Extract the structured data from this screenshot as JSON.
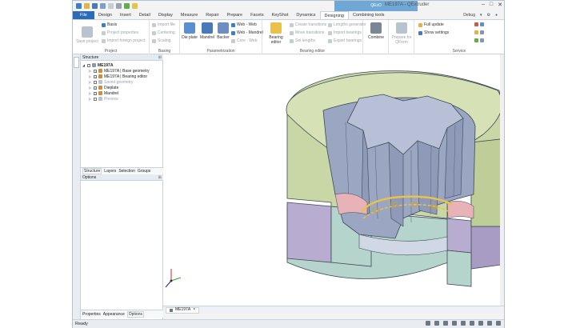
{
  "app": {
    "title": "ME197A - QExtruder",
    "active_context_tab": "QExO"
  },
  "menu": {
    "tabs": [
      "File",
      "Design",
      "Insert",
      "Detail",
      "Display",
      "Measure",
      "Repair",
      "Prepare",
      "Facets",
      "KeyShot",
      "Dynamics",
      "Designing",
      "Combining tools"
    ],
    "active": "Designing",
    "right": {
      "debug": "Debug"
    }
  },
  "ribbon": {
    "project": {
      "name": "Project",
      "save": "Save project",
      "basis": "Basis",
      "project_properties": "Project properties",
      "import_foreign": "Import foreign project"
    },
    "basing": {
      "name": "Basing",
      "import_file": "Import file",
      "centering": "Centering",
      "scaling": "Scaling"
    },
    "parametrization": {
      "name": "Parametrization",
      "die_plate": "Die plate",
      "mandrel": "Mandrel",
      "backer": "Backer",
      "web_web": "Web - Web",
      "web_mandrel": "Web - Mandrel",
      "core_web": "Core - Web"
    },
    "bearing_editor": {
      "name": "Bearing editor",
      "bearing_editor_btn": "Bearing editor",
      "create_transitions": "Create transitions",
      "move_transitions": "Move transitions",
      "set_lengths": "Set lengths",
      "lengths_generator": "Lengths generator",
      "import_bearings": "Import bearings",
      "export_bearings": "Export bearings"
    },
    "combine": {
      "combine": "Combine"
    },
    "qform": {
      "prepare": "Prepare for QForm"
    },
    "service": {
      "name": "Service",
      "full_update": "Full update",
      "show_settings": "Show settings"
    }
  },
  "structure": {
    "header": "Structure",
    "root": "ME197A",
    "items": [
      {
        "label": "ME197A | Base geometry",
        "checked": true,
        "disabled": false
      },
      {
        "label": "ME197A | Bearing editor",
        "checked": true,
        "disabled": false
      },
      {
        "label": "Saved geometry",
        "checked": false,
        "disabled": true
      },
      {
        "label": "Dieplate",
        "checked": true,
        "disabled": false
      },
      {
        "label": "Mandrel",
        "checked": true,
        "disabled": false
      },
      {
        "label": "Preview",
        "checked": false,
        "disabled": true
      }
    ],
    "tabs": [
      "Structure",
      "Layers",
      "Selection",
      "Groups"
    ],
    "active_tab": "Structure"
  },
  "options": {
    "header": "Options",
    "tabs": [
      "Properties",
      "Appearance",
      "Options"
    ],
    "active_tab": "Options"
  },
  "document": {
    "tab": "ME197A"
  },
  "status": {
    "text": "Ready"
  },
  "colors": {
    "accent": "#2b6cb5",
    "context_tab": "#6fa7d6",
    "die_outer": "#c9d6a6",
    "die_inner": "#9aa6c2",
    "backer": "#b8acd0",
    "mandrel_teal": "#b4d4cc",
    "bearing_highlight": "#e8c24a"
  }
}
